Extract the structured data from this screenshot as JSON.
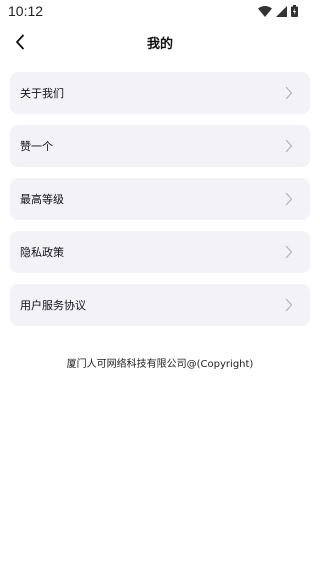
{
  "status_bar": {
    "time": "10:12",
    "icons": [
      "wifi-icon",
      "signal-icon",
      "battery-icon"
    ]
  },
  "header": {
    "title": "我的",
    "back_icon": "chevron-left-icon"
  },
  "menu": {
    "items": [
      {
        "label": "关于我们"
      },
      {
        "label": "赞一个"
      },
      {
        "label": "最高等级"
      },
      {
        "label": "隐私政策"
      },
      {
        "label": "用户服务协议"
      }
    ],
    "chevron_icon": "chevron-right-icon"
  },
  "footer": {
    "copyright": "厦门人可网络科技有限公司@(Copyright)"
  },
  "colors": {
    "card_background": "#f3f3f7",
    "chevron": "#b5b5bb",
    "text": "#111111"
  }
}
